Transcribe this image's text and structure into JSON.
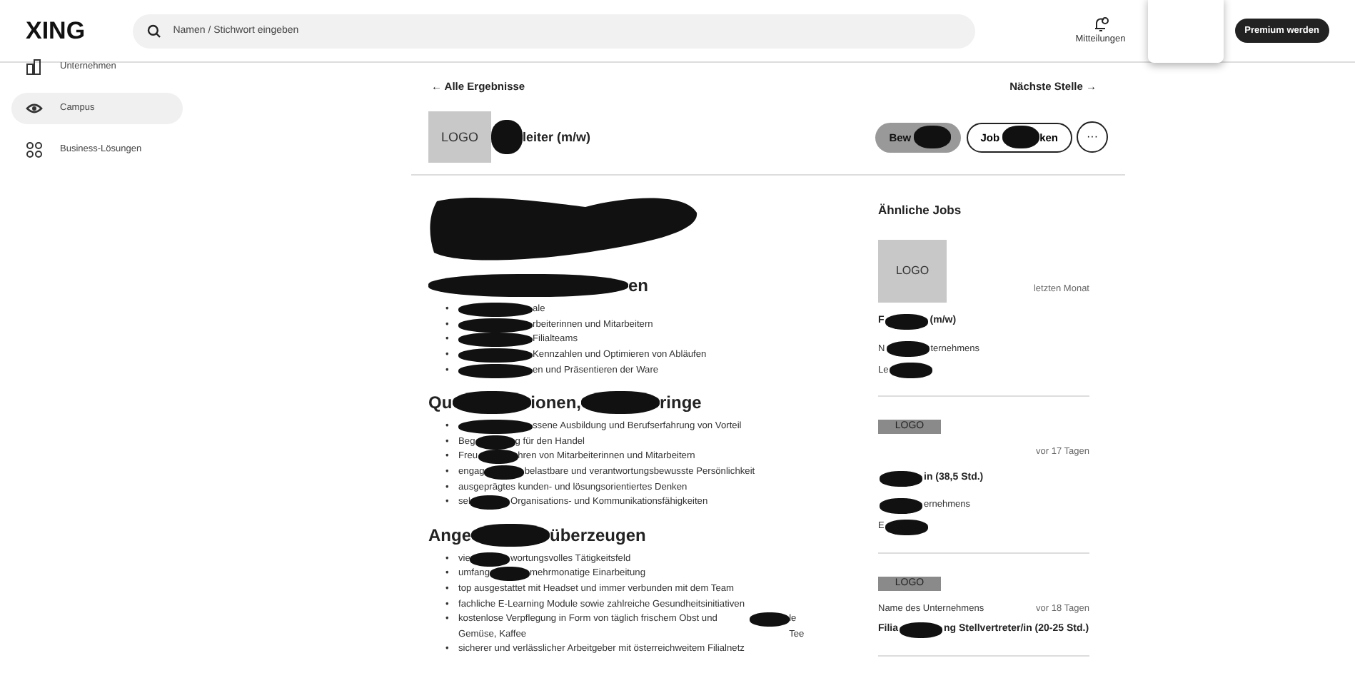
{
  "topbar": {
    "logo": "XING",
    "search": {
      "placeholder": "Namen / Stichwort eingeben"
    },
    "notifications": "Mitteilungen",
    "premium": "Premium werden"
  },
  "sidebar": {
    "items": [
      {
        "label": "Unternehmen",
        "selected": false
      },
      {
        "label": "Campus",
        "selected": true
      },
      {
        "label": "Business-Lösungen",
        "selected": false
      }
    ]
  },
  "nav": {
    "back": "← Alle Ergebnisse",
    "next": "Nächste Stelle →"
  },
  "job_header": {
    "logo": "LOGO",
    "title": [
      {
        "kind": "blob"
      },
      {
        "text": "leiter (m/w)"
      }
    ],
    "apply": [
      {
        "text": "Bew"
      },
      {
        "kind": "blob"
      }
    ],
    "save": [
      {
        "text": "Job"
      },
      {
        "kind": "blob"
      },
      {
        "text": "ken"
      }
    ],
    "more": "···"
  },
  "posting": [
    {
      "kind": "blob"
    },
    {
      "kind": "heading",
      "parts": [
        {
          "kind": "blob"
        },
        {
          "text": "en"
        }
      ]
    },
    {
      "kind": "list",
      "bullet": "•",
      "items": [
        [
          {
            "kind": "blob"
          },
          {
            "text": "ale"
          }
        ],
        [
          {
            "kind": "blob"
          },
          {
            "text": "rbeiterinnen und Mitarbeitern"
          }
        ],
        [
          {
            "kind": "blob"
          },
          {
            "text": "Filialteams"
          }
        ],
        [
          {
            "kind": "blob"
          },
          {
            "text": "Kennzahlen und Optimieren von Abläufen"
          }
        ],
        [
          {
            "kind": "blob"
          },
          {
            "text": "en und Präsentieren der Ware"
          }
        ]
      ]
    },
    {
      "kind": "heading",
      "parts": [
        {
          "text": "Qu"
        },
        {
          "kind": "blob"
        },
        {
          "text": "ionen,"
        },
        {
          "kind": "blob"
        },
        {
          "text": "ringe"
        }
      ]
    },
    {
      "kind": "list",
      "bullet": "•",
      "items": [
        [
          {
            "kind": "blob"
          },
          {
            "text": "ssene Ausbildung und Berufserfahrung von Vorteil"
          }
        ],
        [
          {
            "text": "Beg"
          },
          {
            "kind": "blob"
          },
          {
            "text": "g für den Handel"
          }
        ],
        [
          {
            "text": "Freu"
          },
          {
            "kind": "blob"
          },
          {
            "text": "hren von Mitarbeiterinnen und Mitarbeitern"
          }
        ],
        [
          {
            "text": "engag"
          },
          {
            "kind": "blob"
          },
          {
            "text": "belastbare und verantwortungsbewusste Persönlichkeit"
          }
        ],
        [
          {
            "text": "ausgeprägtes kunden- und lösungsorientiertes Denken"
          }
        ],
        [
          {
            "text": "sel"
          },
          {
            "kind": "blob"
          },
          {
            "text": "Organisations- und Kommunikationsfähigkeiten"
          }
        ]
      ]
    },
    {
      "kind": "heading",
      "parts": [
        {
          "text": "Ange"
        },
        {
          "kind": "blob"
        },
        {
          "text": "überzeugen"
        }
      ]
    },
    {
      "kind": "list",
      "bullet": "•",
      "items": [
        [
          {
            "text": "vie"
          },
          {
            "kind": "blob"
          },
          {
            "text": "wortungsvolles Tätigkeitsfeld"
          }
        ],
        [
          {
            "text": "umfang"
          },
          {
            "kind": "blob"
          },
          {
            "text": "mehrmonatige Einarbeitung"
          }
        ],
        [
          {
            "text": "top ausgestattet mit Headset und immer verbunden mit dem Team"
          }
        ],
        [
          {
            "text": "fachliche E-Learning Module sowie zahlreiche Gesundheitsinitiativen"
          }
        ],
        [
          {
            "text": "kostenlose Verpflegung in Form von täglich frischem Obst und Gemüse, Kaffee"
          },
          {
            "kind": "blob"
          },
          {
            "text": "le Tee"
          }
        ],
        [
          {
            "text": "sicherer und verlässlicher Arbeitgeber mit österreichweitem Filialnetz"
          }
        ]
      ]
    }
  ],
  "similar": {
    "heading": "Ähnliche Jobs",
    "jobs": [
      {
        "logo": "LOGO",
        "kind": "large",
        "age": "letzten Monat",
        "title": [
          {
            "text": "F"
          },
          {
            "kind": "blob"
          },
          {
            "text": "(m/w)"
          }
        ],
        "company": [
          {
            "text": "N"
          },
          {
            "kind": "blob"
          },
          {
            "text": "ternehmens"
          }
        ],
        "place": [
          {
            "text": "Le"
          },
          {
            "kind": "blob"
          }
        ]
      },
      {
        "logo": "LOGO",
        "kind": "bar",
        "age": "vor 17 Tagen",
        "title": [
          {
            "kind": "blob"
          },
          {
            "text": "in (38,5 Std.)"
          }
        ],
        "company": [
          {
            "kind": "blob"
          },
          {
            "text": "ernehmens"
          }
        ],
        "place": [
          {
            "text": "E"
          },
          {
            "kind": "blob"
          }
        ]
      },
      {
        "logo": "LOGO",
        "kind": "bar_top",
        "age": "vor 18 Tagen",
        "company": [
          {
            "text": "Name des Unternehmens"
          }
        ],
        "title": [
          {
            "text": "Filia"
          },
          {
            "kind": "blob"
          },
          {
            "text": "ng Stellvertreter/in (20-25 Std.)"
          }
        ]
      }
    ]
  }
}
